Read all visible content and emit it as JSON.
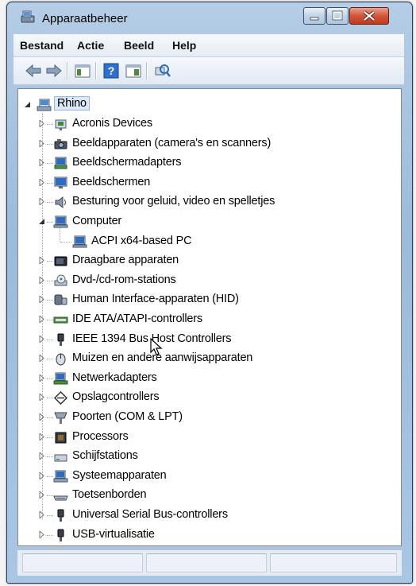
{
  "window": {
    "title": "Apparaatbeheer",
    "icons": {
      "app": "device-manager-icon",
      "minimize": "minimize-icon",
      "maximize": "maximize-icon",
      "close": "close-icon"
    }
  },
  "menu": {
    "items": [
      "Bestand",
      "Actie",
      "Beeld",
      "Help"
    ]
  },
  "toolbar": {
    "buttons": [
      "back-arrow-icon",
      "forward-arrow-icon",
      "show-hide-tree-icon",
      "help-icon",
      "properties-icon",
      "scan-hardware-icon"
    ]
  },
  "tree": {
    "root": {
      "label": "Rhino",
      "icon": "computer-network-icon",
      "expanded": true
    },
    "items": [
      {
        "label": "Acronis Devices",
        "icon": "device-icon",
        "expanded": false
      },
      {
        "label": "Beeldapparaten (camera's en scanners)",
        "icon": "camera-icon",
        "expanded": false
      },
      {
        "label": "Beeldschermadapters",
        "icon": "display-adapter-icon",
        "expanded": false
      },
      {
        "label": "Beeldschermen",
        "icon": "monitor-icon",
        "expanded": false
      },
      {
        "label": "Besturing voor geluid, video en spelletjes",
        "icon": "speaker-icon",
        "expanded": false
      },
      {
        "label": "Computer",
        "icon": "computer-icon",
        "expanded": true,
        "children": [
          {
            "label": "ACPI x64-based PC",
            "icon": "computer-icon"
          }
        ]
      },
      {
        "label": "Draagbare apparaten",
        "icon": "portable-device-icon",
        "expanded": false
      },
      {
        "label": "Dvd-/cd-rom-stations",
        "icon": "dvd-drive-icon",
        "expanded": false
      },
      {
        "label": "Human Interface-apparaten (HID)",
        "icon": "hid-icon",
        "expanded": false
      },
      {
        "label": "IDE ATA/ATAPI-controllers",
        "icon": "ide-controller-icon",
        "expanded": false
      },
      {
        "label": "IEEE 1394 Bus Host Controllers",
        "icon": "firewire-icon",
        "expanded": false
      },
      {
        "label": "Muizen en andere aanwijsapparaten",
        "icon": "mouse-icon",
        "expanded": false
      },
      {
        "label": "Netwerkadapters",
        "icon": "network-adapter-icon",
        "expanded": false
      },
      {
        "label": "Opslagcontrollers",
        "icon": "storage-controller-icon",
        "expanded": false
      },
      {
        "label": "Poorten (COM & LPT)",
        "icon": "port-icon",
        "expanded": false
      },
      {
        "label": "Processors",
        "icon": "processor-icon",
        "expanded": false
      },
      {
        "label": "Schijfstations",
        "icon": "disk-drive-icon",
        "expanded": false
      },
      {
        "label": "Systeemapparaten",
        "icon": "system-device-icon",
        "expanded": false
      },
      {
        "label": "Toetsenborden",
        "icon": "keyboard-icon",
        "expanded": false
      },
      {
        "label": "Universal Serial Bus-controllers",
        "icon": "usb-icon",
        "expanded": false
      },
      {
        "label": "USB-virtualisatie",
        "icon": "usb-icon",
        "expanded": false
      }
    ]
  }
}
